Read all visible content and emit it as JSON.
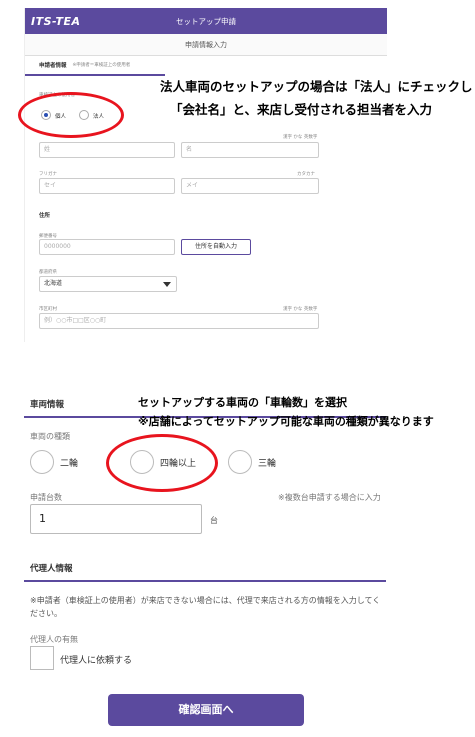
{
  "top": {
    "logo": "ITS-TEA",
    "title": "セットアップ申請",
    "subheader": "申請情報入力",
    "section_title": "申請者情報",
    "section_note": "※申請者＝車検証上の使用者",
    "user_type_label": "車検証上の使用者",
    "options": [
      "個人",
      "法人"
    ],
    "kanji_hint": "漢字 かな 英数字",
    "last_name_placeholder": "姓",
    "first_name_placeholder": "名",
    "furigana_label": "フリガナ",
    "katakana_hint": "カタカナ",
    "sei_placeholder": "セイ",
    "mei_placeholder": "メイ",
    "address_heading": "住所",
    "postal_label": "郵便番号",
    "postal_placeholder": "0000000",
    "auto_address_button": "住所を自動入力",
    "prefecture_label": "都道府県",
    "prefecture_value": "北海道",
    "city_label": "市区町村",
    "city_hint": "漢字 かな 英数字",
    "city_placeholder": "例）○○市□□区○○町"
  },
  "annotation1": {
    "line1": "法人車両のセットアップの場合は「法人」にチェックし",
    "line2": "「会社名」と、来店し受付される担当者を入力"
  },
  "annotation2": {
    "line1": "セットアップする車両の「車輪数」を選択",
    "line2": "※店舗によってセットアップ可能な車両の種類が異なります"
  },
  "bottom": {
    "vehicle_heading": "車両情報",
    "vehicle_type_label": "車両の種類",
    "wheel_options": [
      "二輪",
      "四輪以上",
      "三輪"
    ],
    "count_label": "申請台数",
    "count_note": "※複数台申請する場合に入力",
    "count_value": "1",
    "count_unit": "台",
    "agent_heading": "代理人情報",
    "agent_note": "※申請者（車検証上の使用者）が来店できない場合には、代理で来店される方の情報を入力してください。",
    "agent_presence_label": "代理人の有無",
    "agent_checkbox_label": "代理人に依頼する",
    "confirm_button": "確認画面へ"
  }
}
